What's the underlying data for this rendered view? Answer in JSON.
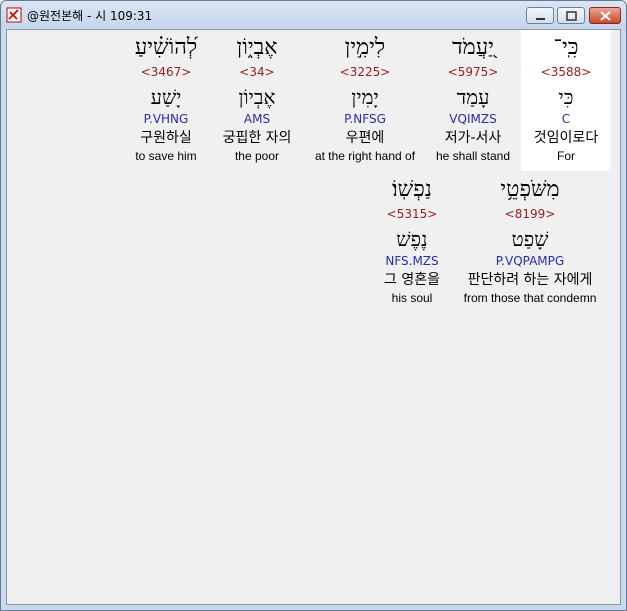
{
  "window": {
    "title": "@원전본해 - 시 109:31"
  },
  "words": [
    {
      "hebrew": "כִּֽי־",
      "strong": "<3588>",
      "lemma": "כִּי",
      "parse": "C",
      "korean": "것임이로다",
      "english": "For"
    },
    {
      "hebrew": "יַ֭עֲמֹד",
      "strong": "<5975>",
      "lemma": "עָמַד",
      "parse": "VQIMZS",
      "korean": "저가-서사",
      "english": "he shall stand"
    },
    {
      "hebrew": "לִימִ֣ין",
      "strong": "<3225>",
      "lemma": "יָמִין",
      "parse": "P.NFSG",
      "korean": "우편에",
      "english": "at the right hand of"
    },
    {
      "hebrew": "אֶבְי֑וֹן",
      "strong": "<34>",
      "lemma": "אֶבְיוֹן",
      "parse": "AMS",
      "korean": "궁핍한 자의",
      "english": "the poor"
    },
    {
      "hebrew": "לְ֝הוֹשִׁ֗יעַ",
      "strong": "<3467>",
      "lemma": "יָשַׁע",
      "parse": "P.VHNG",
      "korean": "구원하실",
      "english": "to save him"
    },
    {
      "hebrew": "מִשֹּׁפְטֵ֥י",
      "strong": "<8199>",
      "lemma": "שָׁפַט",
      "parse": "P.VQPAMPG",
      "korean": "판단하려 하는 자에게",
      "english": "from those that condemn"
    },
    {
      "hebrew": "נַפְשֽׁוֹ׃",
      "strong": "<5315>",
      "lemma": "נֶפֶשׁ",
      "parse": "NFS.MZS",
      "korean": "그 영혼을",
      "english": "his soul"
    }
  ]
}
